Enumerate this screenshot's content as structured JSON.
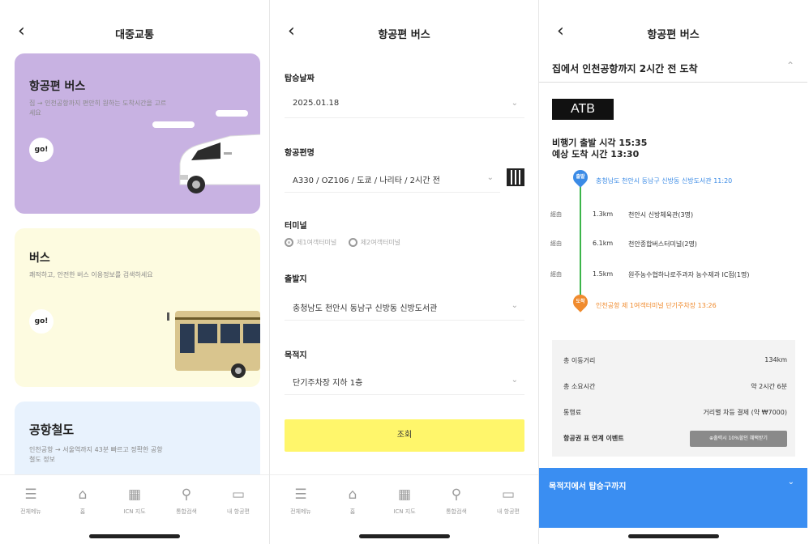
{
  "colors": {
    "purple_card": "#c8b2e2",
    "yellow_card": "#fdfbe0",
    "blue_card": "#e8f2fd",
    "search_button": "#fff66b",
    "route_line": "#3cb54a",
    "start_pin": "#3b8be6",
    "end_pin": "#f08b2e",
    "blue_panel": "#3a8ef2"
  },
  "screen1": {
    "back": "‹",
    "title": "대중교통",
    "cards": [
      {
        "title": "항공편 버스",
        "desc": "집 → 인천공항까지 편안히 원하는 도착시간을 고르세요",
        "go": "go!"
      },
      {
        "title": "버스",
        "desc": "쾌적하고, 안전한 버스 이용정보를 검색하세요",
        "go": "go!"
      },
      {
        "title": "공항철도",
        "desc": "인천공항 → 서울역까지 43분 빠르고 정확한 공항철도 정보"
      }
    ]
  },
  "tabbar": [
    {
      "icon": "menu-icon",
      "glyph": "☰",
      "label": "전체메뉴"
    },
    {
      "icon": "home-icon",
      "glyph": "⌂",
      "label": "홈"
    },
    {
      "icon": "map-icon",
      "glyph": "▦",
      "label": "ICN 지도"
    },
    {
      "icon": "search-icon",
      "glyph": "⚲",
      "label": "통합검색"
    },
    {
      "icon": "ticket-icon",
      "glyph": "▭",
      "label": "내 항공편"
    }
  ],
  "screen2": {
    "back": "‹",
    "title": "항공편 버스",
    "date_label": "탑승날짜",
    "date_value": "2025.01.18",
    "flight_label": "항공편명",
    "flight_value": "A330 / OZ106 / 도쿄 / 나리타 / 2시간 전",
    "terminal_label": "터미널",
    "terminal_options": [
      "제1여객터미널",
      "제2여객터미널"
    ],
    "origin_label": "출발지",
    "origin_value": "충청남도 천안시 동남구 신방동 신방도서관",
    "dest_label": "목적지",
    "dest_value": "단기주차장 지하 1층",
    "search_label": "조회",
    "chevron": "⌄"
  },
  "screen3": {
    "back": "‹",
    "title": "항공편 버스",
    "section_title": "집에서 인천공항까지 2시간 전 도착",
    "section_chevron": "⌃",
    "atb": "ATB",
    "departure": "비행기 출발 시각 15:35",
    "arrival": "예상 도착 시간 13:30",
    "start_pin": "출발",
    "start_stop": "충청남도 천안시 동남구 신방동 신방도서관 11:20",
    "vias": [
      {
        "tag": "經由",
        "dist": "1.3km",
        "name": "천안시 신방체육관(3명)"
      },
      {
        "tag": "經由",
        "dist": "6.1km",
        "name": "천안종합버스터미널(2명)"
      },
      {
        "tag": "經由",
        "dist": "1.5km",
        "name": "원주농수협하나로주과자 농수제과 IC점(1명)"
      }
    ],
    "end_pin": "도착",
    "end_stop": "인천공항 제 1여객터미널 단기주차장 13:26",
    "info": [
      {
        "k": "총 이동거리",
        "v": "134km"
      },
      {
        "k": "총 소요시간",
        "v": "약 2시간 6분"
      },
      {
        "k": "통행료",
        "v": "거리별 차등 결제 (약 ₩7000)"
      }
    ],
    "event_label": "항공권 표 연계 이벤트",
    "event_button": "⊕출력시 10%할인 혜택받기",
    "panel_title": "목적지에서 탑승구까지",
    "panel_chevron": "⌄"
  }
}
